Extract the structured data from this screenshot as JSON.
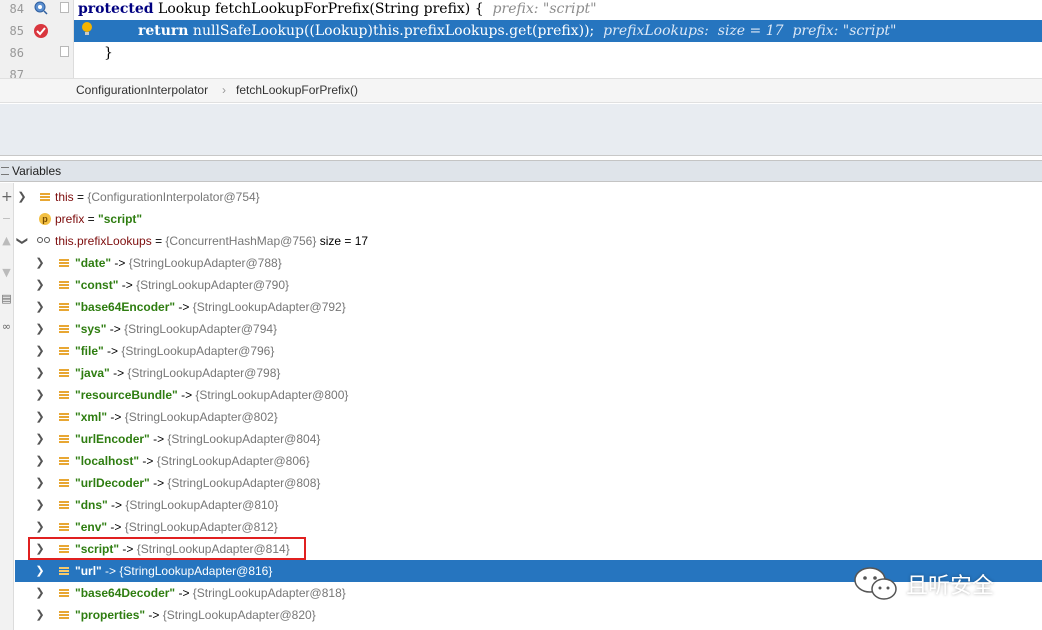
{
  "editor": {
    "lines": [
      {
        "num": "84",
        "kw": "protected",
        "code": " Lookup fetchLookupForPrefix(String prefix) {",
        "hint": "  prefix: \"script\""
      },
      {
        "num": "85",
        "kw": "return",
        "code": " nullSafeLookup((Lookup)this.prefixLookups.get(prefix));",
        "hint": "  prefixLookups:  size = 17  prefix: \"script\""
      },
      {
        "num": "86",
        "kw": "",
        "code": "}",
        "hint": ""
      },
      {
        "num": "87",
        "kw": "",
        "code": "",
        "hint": ""
      }
    ]
  },
  "breadcrumb": {
    "items": [
      "ConfigurationInterpolator",
      "fetchLookupForPrefix()"
    ],
    "separator": "›"
  },
  "variables": {
    "title": "Variables",
    "rows": [
      {
        "icon": "field-icon",
        "name": "this",
        "eq": " = ",
        "ref": "{ConfigurationInterpolator@754}",
        "level": 0
      },
      {
        "icon": "parameter-icon",
        "icon_letter": "p",
        "name": "prefix",
        "eq": " = ",
        "str": "\"script\"",
        "level": 0
      },
      {
        "icon": "watch-icon",
        "name": "this.prefixLookups",
        "eq": " = ",
        "ref": "{ConcurrentHashMap@756}",
        "extra": "  size = 17",
        "level": 0,
        "expanded": true
      },
      {
        "key": "\"date\"",
        "arrow_sep": " -> ",
        "ref": "{StringLookupAdapter@788}",
        "level": 1
      },
      {
        "key": "\"const\"",
        "arrow_sep": " -> ",
        "ref": "{StringLookupAdapter@790}",
        "level": 1
      },
      {
        "key": "\"base64Encoder\"",
        "arrow_sep": " -> ",
        "ref": "{StringLookupAdapter@792}",
        "level": 1
      },
      {
        "key": "\"sys\"",
        "arrow_sep": " -> ",
        "ref": "{StringLookupAdapter@794}",
        "level": 1
      },
      {
        "key": "\"file\"",
        "arrow_sep": " -> ",
        "ref": "{StringLookupAdapter@796}",
        "level": 1
      },
      {
        "key": "\"java\"",
        "arrow_sep": " -> ",
        "ref": "{StringLookupAdapter@798}",
        "level": 1
      },
      {
        "key": "\"resourceBundle\"",
        "arrow_sep": " -> ",
        "ref": "{StringLookupAdapter@800}",
        "level": 1
      },
      {
        "key": "\"xml\"",
        "arrow_sep": " -> ",
        "ref": "{StringLookupAdapter@802}",
        "level": 1
      },
      {
        "key": "\"urlEncoder\"",
        "arrow_sep": " -> ",
        "ref": "{StringLookupAdapter@804}",
        "level": 1
      },
      {
        "key": "\"localhost\"",
        "arrow_sep": " -> ",
        "ref": "{StringLookupAdapter@806}",
        "level": 1
      },
      {
        "key": "\"urlDecoder\"",
        "arrow_sep": " -> ",
        "ref": "{StringLookupAdapter@808}",
        "level": 1
      },
      {
        "key": "\"dns\"",
        "arrow_sep": " -> ",
        "ref": "{StringLookupAdapter@810}",
        "level": 1
      },
      {
        "key": "\"env\"",
        "arrow_sep": " -> ",
        "ref": "{StringLookupAdapter@812}",
        "level": 1
      },
      {
        "key": "\"script\"",
        "arrow_sep": " -> ",
        "ref": "{StringLookupAdapter@814}",
        "level": 1,
        "highlighted": true
      },
      {
        "key": "\"url\"",
        "arrow_sep": " -> ",
        "ref": "{StringLookupAdapter@816}",
        "level": 1,
        "selected": true
      },
      {
        "key": "\"base64Decoder\"",
        "arrow_sep": " -> ",
        "ref": "{StringLookupAdapter@818}",
        "level": 1
      },
      {
        "key": "\"properties\"",
        "arrow_sep": " -> ",
        "ref": "{StringLookupAdapter@820}",
        "level": 1
      }
    ]
  },
  "watermark": {
    "label": "且听安全"
  },
  "colors": {
    "selection": "#2675bf",
    "keyword": "#000080",
    "hint": "#8c8c8c",
    "string_key": "#2e7d10",
    "reference": "#777777",
    "var_name": "#7d0c0c",
    "highlight_box": "#e02020",
    "field_icon": "#e8a733"
  }
}
